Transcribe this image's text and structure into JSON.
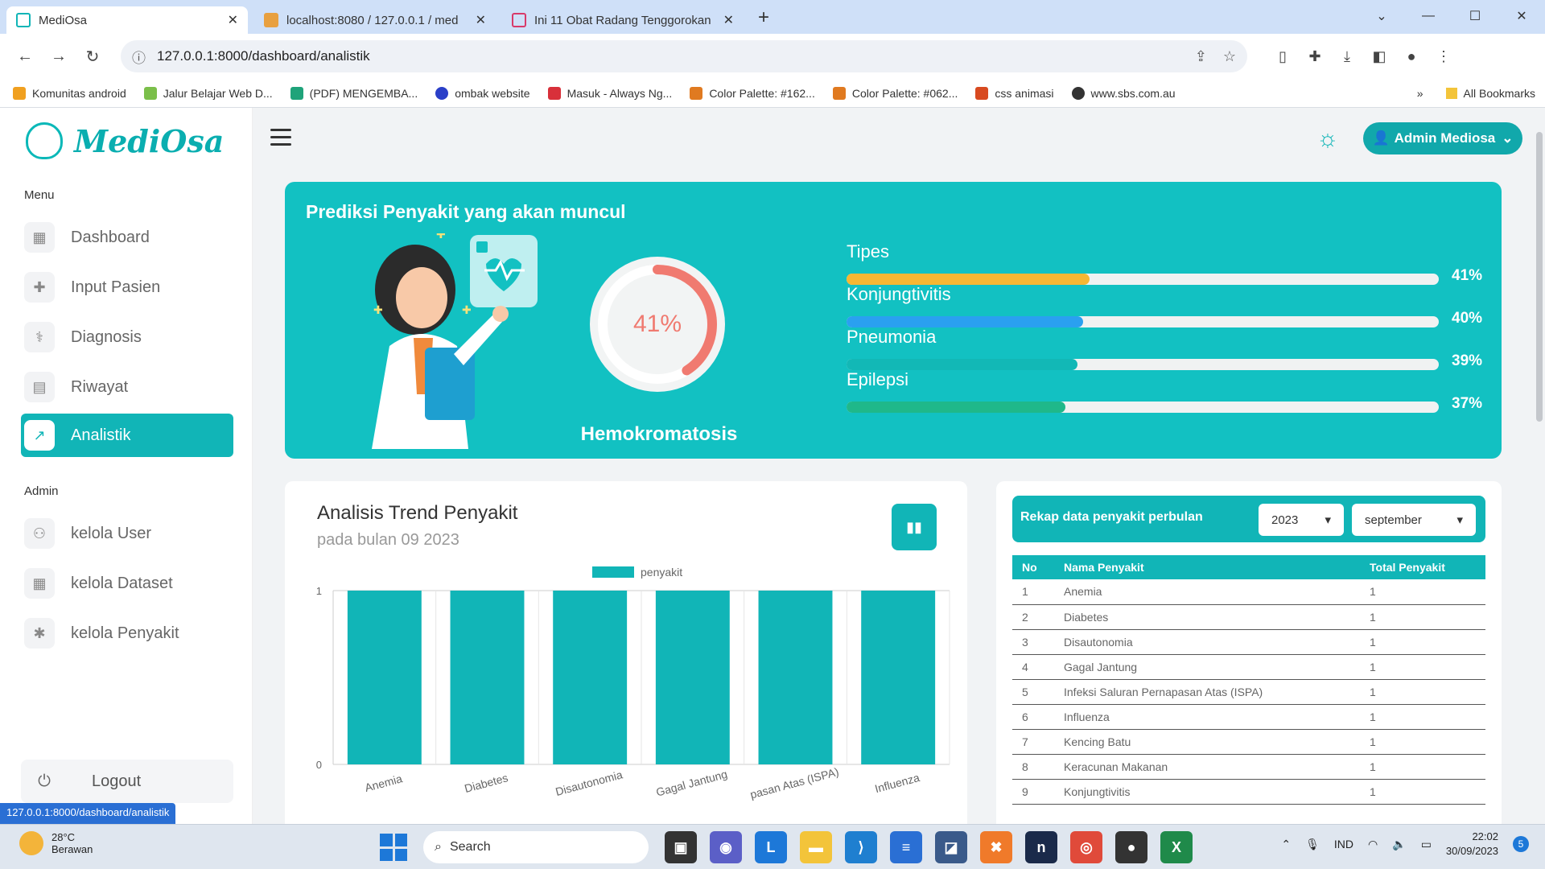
{
  "browser": {
    "tabs": [
      {
        "title": "MediOsa",
        "color": "#11b5b7"
      },
      {
        "title": "localhost:8080 / 127.0.0.1 / med",
        "color": "#e8a040"
      },
      {
        "title": "Ini 11 Obat Radang Tenggorokan",
        "color": "#d83a6a"
      }
    ],
    "url": "127.0.0.1:8000/dashboard/analistik",
    "bookmarks": [
      {
        "label": "Komunitas android",
        "color": "#f0a020"
      },
      {
        "label": "Jalur Belajar Web D...",
        "color": "#7bbf4a"
      },
      {
        "label": "(PDF) MENGEMBA...",
        "color": "#1fa37a"
      },
      {
        "label": "ombak website",
        "color": "#2a3fc8"
      },
      {
        "label": "Masuk - Always Ng...",
        "color": "#d8303a"
      },
      {
        "label": "Color Palette: #162...",
        "color": "#e07a20"
      },
      {
        "label": "Color Palette: #062...",
        "color": "#e07a20"
      },
      {
        "label": "css animasi",
        "color": "#d84a20"
      },
      {
        "label": "www.sbs.com.au",
        "color": "#333333"
      }
    ],
    "all_bookmarks": "All Bookmarks",
    "status_url": "127.0.0.1:8000/dashboard/analistik"
  },
  "app": {
    "logo_text": "MediOsa",
    "menu_heading": "Menu",
    "admin_heading": "Admin",
    "menu": [
      {
        "label": "Dashboard",
        "icon": "grid-icon",
        "glyph": "▦"
      },
      {
        "label": "Input Pasien",
        "icon": "user-plus-icon",
        "glyph": "👤"
      },
      {
        "label": "Diagnosis",
        "icon": "stethoscope-icon",
        "glyph": "⚕"
      },
      {
        "label": "Riwayat",
        "icon": "document-icon",
        "glyph": "▤"
      },
      {
        "label": "Analistik",
        "icon": "chart-line-icon",
        "glyph": "📈"
      }
    ],
    "admin_menu": [
      {
        "label": "kelola User",
        "icon": "users-cog-icon",
        "glyph": "👥"
      },
      {
        "label": "kelola Dataset",
        "icon": "table-icon",
        "glyph": "▦"
      },
      {
        "label": "kelola Penyakit",
        "icon": "gear-icon",
        "glyph": "✱"
      }
    ],
    "logout_label": "Logout",
    "user_button": "Admin Mediosa"
  },
  "hero": {
    "title": "Prediksi Penyakit yang akan muncul",
    "main_disease": "Hemokromatosis",
    "main_percent_label": "41%",
    "main_percent": 41,
    "bars": [
      {
        "name": "Tipes",
        "percent": 41,
        "label": "41%",
        "color": "#f6b733"
      },
      {
        "name": "Konjungtivitis",
        "percent": 40,
        "label": "40%",
        "color": "#2aa0f0"
      },
      {
        "name": "Pneumonia",
        "percent": 39,
        "label": "39%",
        "color": "#12b8b6"
      },
      {
        "name": "Epilepsi",
        "percent": 37,
        "label": "37%",
        "color": "#1fb88a"
      }
    ]
  },
  "trend": {
    "title": "Analisis Trend Penyakit",
    "subtitle": "pada bulan 09 2023"
  },
  "chart_data": {
    "type": "bar",
    "categories": [
      "Anemia",
      "Diabetes",
      "Disautonomia",
      "Gagal Jantung",
      "Infeksi Saluran Pernapasan Atas (ISPA)",
      "Influenza"
    ],
    "tick_labels": [
      "Anemia",
      "Diabetes",
      "Disautonomia",
      "Gagal Jantung",
      "pasan Atas (ISPA)",
      "Influenza"
    ],
    "series": [
      {
        "name": "penyakit",
        "values": [
          1,
          1,
          1,
          1,
          1,
          1
        ]
      }
    ],
    "ylim": [
      0,
      1
    ],
    "yticks": [
      "0",
      "1"
    ],
    "color": "#11b5b7",
    "legend": "top"
  },
  "rekap": {
    "title": "Rekap data penyakit perbulan",
    "year": "2023",
    "month": "september",
    "columns": [
      "No",
      "Nama Penyakit",
      "Total Penyakit"
    ],
    "rows": [
      [
        "1",
        "Anemia",
        "1"
      ],
      [
        "2",
        "Diabetes",
        "1"
      ],
      [
        "3",
        "Disautonomia",
        "1"
      ],
      [
        "4",
        "Gagal Jantung",
        "1"
      ],
      [
        "5",
        "Infeksi Saluran Pernapasan Atas (ISPA)",
        "1"
      ],
      [
        "6",
        "Influenza",
        "1"
      ],
      [
        "7",
        "Kencing Batu",
        "1"
      ],
      [
        "8",
        "Keracunan Makanan",
        "1"
      ],
      [
        "9",
        "Konjungtivitis",
        "1"
      ]
    ]
  },
  "taskbar": {
    "weather_temp": "28°C",
    "weather_desc": "Berawan",
    "search": "Search",
    "lang": "IND",
    "time": "22:02",
    "date": "30/09/2023",
    "notif_count": "5"
  }
}
